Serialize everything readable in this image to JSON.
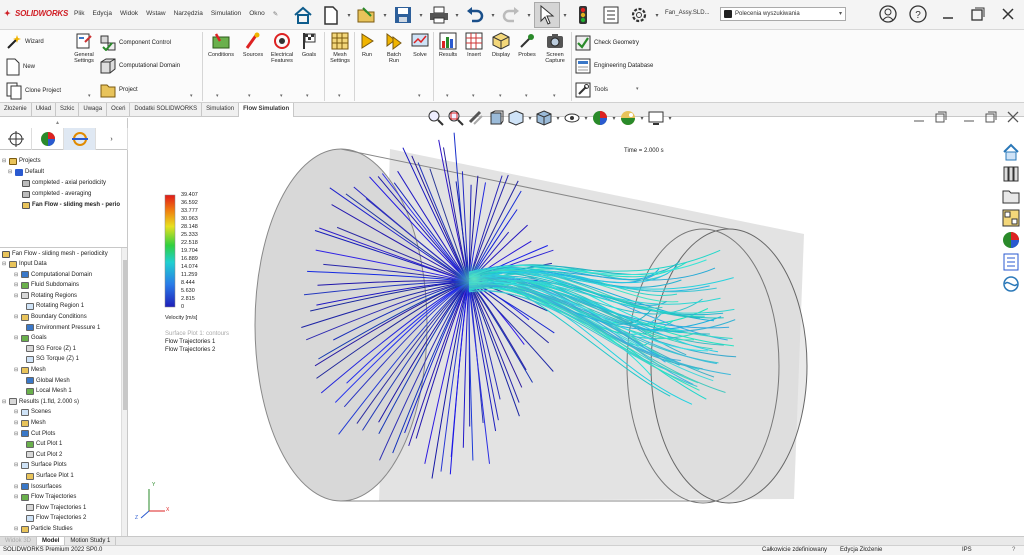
{
  "app": {
    "logo_text": "SOLIDWORKS",
    "document_title": "Fan_Assy.SLD...",
    "search_placeholder": "Polecenia wyszukiwania"
  },
  "menu": [
    "Plik",
    "Edycja",
    "Widok",
    "Wstaw",
    "Narzędzia",
    "Simulation",
    "Okno"
  ],
  "ribbon": {
    "wizard": "Wizard",
    "new": "New",
    "clone_project": "Clone Project",
    "general_settings": "General\nSettings",
    "component_control": "Component Control",
    "computational_domain": "Computational Domain",
    "project": "Project",
    "conditions": "Conditions",
    "sources": "Sources",
    "electrical_features": "Electrical\nFeatures",
    "goals": "Goals",
    "mesh_settings": "Mesh\nSettings",
    "run": "Run",
    "batch_run": "Batch\nRun",
    "solve": "Solve",
    "results": "Results",
    "insert": "Insert",
    "display": "Display",
    "probes": "Probes",
    "screen_capture": "Screen\nCapture",
    "check_geometry": "Check Geometry",
    "engineering_database": "Engineering Database",
    "tools": "Tools"
  },
  "tabs": [
    "Złożenie",
    "Układ",
    "Szkic",
    "Uwaga",
    "Oceń",
    "Dodatki SOLIDWORKS",
    "Simulation",
    "Flow Simulation"
  ],
  "active_tab": "Flow Simulation",
  "projects_tree": {
    "root": "Projects",
    "default": "Default",
    "items": [
      "completed - axial periodicity",
      "completed - averaging",
      "Fan Flow - sliding mesh - perio"
    ]
  },
  "analysis_tree": {
    "root": "Fan Flow - sliding mesh - periodicity",
    "rows": [
      {
        "label": "Input Data",
        "level": 1
      },
      {
        "label": "Computational Domain",
        "level": 2
      },
      {
        "label": "Fluid Subdomains",
        "level": 2
      },
      {
        "label": "Rotating Regions",
        "level": 2
      },
      {
        "label": "Rotating Region 1",
        "level": 3
      },
      {
        "label": "Boundary Conditions",
        "level": 2
      },
      {
        "label": "Environment Pressure 1",
        "level": 3
      },
      {
        "label": "Goals",
        "level": 2
      },
      {
        "label": "SG Force (Z) 1",
        "level": 3
      },
      {
        "label": "SG Torque (Z) 1",
        "level": 3
      },
      {
        "label": "Mesh",
        "level": 2
      },
      {
        "label": "Global Mesh",
        "level": 3
      },
      {
        "label": "Local Mesh 1",
        "level": 3
      },
      {
        "label": "Results (1.fld, 2.000 s)",
        "level": 1
      },
      {
        "label": "Scenes",
        "level": 2
      },
      {
        "label": "Mesh",
        "level": 2
      },
      {
        "label": "Cut Plots",
        "level": 2
      },
      {
        "label": "Cut Plot 1",
        "level": 3
      },
      {
        "label": "Cut Plot 2",
        "level": 3
      },
      {
        "label": "Surface Plots",
        "level": 2
      },
      {
        "label": "Surface Plot 1",
        "level": 3
      },
      {
        "label": "Isosurfaces",
        "level": 2
      },
      {
        "label": "Flow Trajectories",
        "level": 2
      },
      {
        "label": "Flow Trajectories 1",
        "level": 3
      },
      {
        "label": "Flow Trajectories 2",
        "level": 3
      },
      {
        "label": "Particle Studies",
        "level": 2
      }
    ]
  },
  "viewport": {
    "time_label": "Time = 2.000 s",
    "legend_unit": "Velocity [m/s]",
    "legend_values": [
      "39.407",
      "36.592",
      "33.777",
      "30.963",
      "28.148",
      "25.333",
      "22.518",
      "19.704",
      "16.889",
      "14.074",
      "11.259",
      "8.444",
      "5.630",
      "2.815",
      "0"
    ],
    "plot_list_faded": "Surface Plot 1: contours",
    "plot_list": [
      "Flow Trajectories 1",
      "Flow Trajectories 2"
    ],
    "axis_labels": [
      "X",
      "Y",
      "Z"
    ]
  },
  "bottom_tabs": [
    "Model",
    "Motion Study 1"
  ],
  "bottom_tab_faded": "Widok 3D",
  "status": {
    "version": "SOLIDWORKS Premium 2022 SP0.0",
    "definition": "Całkowicie zdefiniowany",
    "mode": "Edycja Złożenie",
    "units": "IPS"
  },
  "colors": {
    "brand": "#d01f26",
    "legend_top": "#e11a1a",
    "legend_bottom": "#1f1fb8",
    "trajectory_blue": "#2a2ad0",
    "trajectory_cyan": "#25b6c8"
  }
}
